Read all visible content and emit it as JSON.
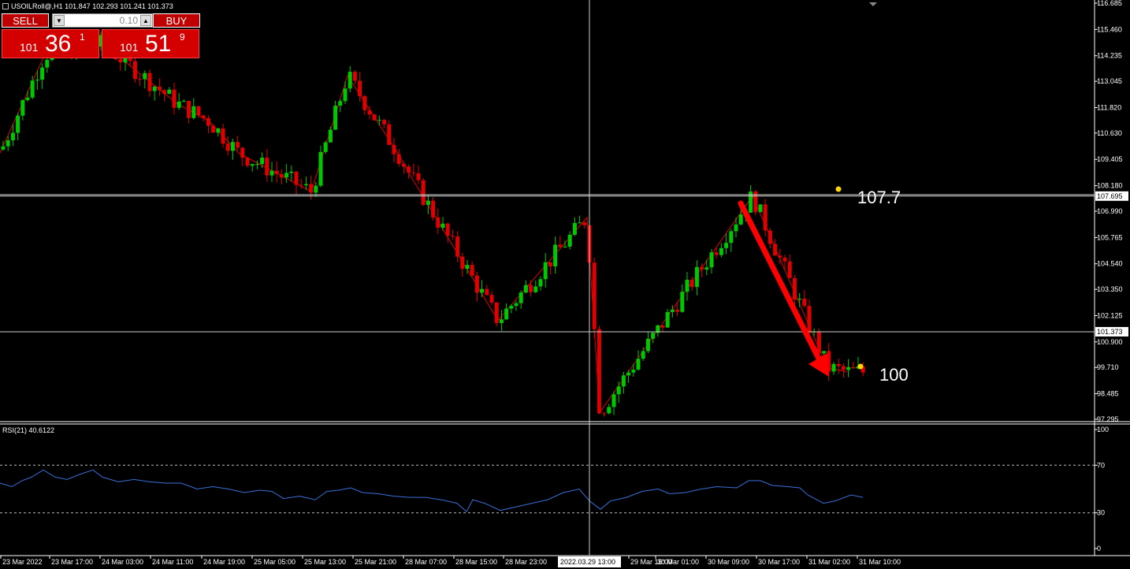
{
  "window": {
    "title": "USOILRoll@,H1 101.847 102.293 101.241 101.373"
  },
  "trade_panel": {
    "sell_label": "SELL",
    "buy_label": "BUY",
    "lot_value": "0.10",
    "sell_price_prefix": "101",
    "sell_price_big": "36",
    "sell_price_sup": "1",
    "buy_price_prefix": "101",
    "buy_price_big": "51",
    "buy_price_sup": "9"
  },
  "price_axis": {
    "ticks": [
      "116.685",
      "115.460",
      "114.235",
      "113.045",
      "111.820",
      "110.630",
      "109.405",
      "108.180",
      "106.990",
      "105.765",
      "104.540",
      "103.350",
      "102.125",
      "100.900",
      "99.710",
      "98.485",
      "97.295"
    ],
    "tick_values": [
      116.685,
      115.46,
      114.235,
      113.045,
      111.82,
      110.63,
      109.405,
      108.18,
      106.99,
      105.765,
      104.54,
      103.35,
      102.125,
      100.9,
      99.71,
      98.485,
      97.295
    ],
    "hline_labels": [
      "107.695",
      "101.373"
    ],
    "hline_values": [
      107.695,
      101.373
    ]
  },
  "annotations": {
    "level_high": "107.7",
    "level_low": "100"
  },
  "rsi": {
    "label": "RSI(21) 40.6122",
    "ticks": [
      "100",
      "70",
      "30",
      "0"
    ],
    "tick_values": [
      100,
      70,
      30,
      0
    ],
    "levels": [
      70,
      30
    ]
  },
  "time_axis": {
    "labels": [
      "23 Mar 2022",
      "23 Mar 17:00",
      "24 Mar 03:00",
      "24 Mar 11:00",
      "24 Mar 19:00",
      "25 Mar 05:00",
      "25 Mar 13:00",
      "25 Mar 21:00",
      "28 Mar 07:00",
      "28 Mar 15:00",
      "28 Mar 23:00",
      "29 Mar 16:00",
      "30 Mar 01:00",
      "30 Mar 09:00",
      "30 Mar 17:00",
      "31 Mar 02:00",
      "31 Mar 10:00"
    ],
    "crosshair_label": "2022.03.29 13:00"
  },
  "colors": {
    "bull": "#00c800",
    "bear": "#e00000",
    "rsi_line": "#3a6fd8",
    "zigzag": "#e00000",
    "dot": "#ffd700"
  },
  "chart_data": {
    "type": "candlestick",
    "symbol": "USOILRoll@",
    "timeframe": "H1",
    "ohlc_current": {
      "open": 101.847,
      "high": 102.293,
      "low": 101.241,
      "close": 101.373
    },
    "ylim": [
      96.7,
      117.1
    ],
    "zigzag": [
      [
        0,
        109.7
      ],
      [
        57,
        114.3
      ],
      [
        130,
        114.8
      ],
      [
        225,
        112.0
      ],
      [
        265,
        111.2
      ],
      [
        303,
        109.7
      ],
      [
        395,
        107.9
      ],
      [
        441,
        113.3
      ],
      [
        505,
        109.7
      ],
      [
        520,
        108.7
      ],
      [
        632,
        101.9
      ],
      [
        745,
        106.7
      ],
      [
        761,
        97.6
      ],
      [
        955,
        107.7
      ],
      [
        1050,
        99.7
      ],
      [
        1075,
        99.5
      ]
    ],
    "rsi_values": [
      [
        0,
        55
      ],
      [
        15,
        52
      ],
      [
        28,
        57
      ],
      [
        40,
        60
      ],
      [
        55,
        66
      ],
      [
        70,
        60
      ],
      [
        85,
        58
      ],
      [
        100,
        62
      ],
      [
        118,
        66
      ],
      [
        130,
        60
      ],
      [
        150,
        56
      ],
      [
        170,
        58
      ],
      [
        190,
        56
      ],
      [
        210,
        55
      ],
      [
        230,
        55
      ],
      [
        250,
        50
      ],
      [
        270,
        52
      ],
      [
        290,
        50
      ],
      [
        310,
        47
      ],
      [
        330,
        49
      ],
      [
        345,
        48
      ],
      [
        360,
        42
      ],
      [
        380,
        44
      ],
      [
        400,
        41
      ],
      [
        415,
        48
      ],
      [
        430,
        49
      ],
      [
        445,
        51
      ],
      [
        460,
        47
      ],
      [
        480,
        46
      ],
      [
        500,
        44
      ],
      [
        520,
        43
      ],
      [
        540,
        43
      ],
      [
        560,
        41
      ],
      [
        580,
        38
      ],
      [
        592,
        31
      ],
      [
        600,
        41
      ],
      [
        615,
        38
      ],
      [
        635,
        32
      ],
      [
        655,
        35
      ],
      [
        675,
        38
      ],
      [
        695,
        41
      ],
      [
        715,
        47
      ],
      [
        735,
        50
      ],
      [
        748,
        40
      ],
      [
        762,
        33
      ],
      [
        775,
        40
      ],
      [
        795,
        43
      ],
      [
        815,
        48
      ],
      [
        835,
        50
      ],
      [
        850,
        46
      ],
      [
        870,
        47
      ],
      [
        890,
        50
      ],
      [
        910,
        52
      ],
      [
        935,
        51
      ],
      [
        950,
        57
      ],
      [
        965,
        57
      ],
      [
        980,
        53
      ],
      [
        1000,
        52
      ],
      [
        1015,
        51
      ],
      [
        1025,
        45
      ],
      [
        1045,
        38
      ],
      [
        1060,
        40
      ],
      [
        1080,
        45
      ],
      [
        1095,
        43
      ]
    ]
  }
}
